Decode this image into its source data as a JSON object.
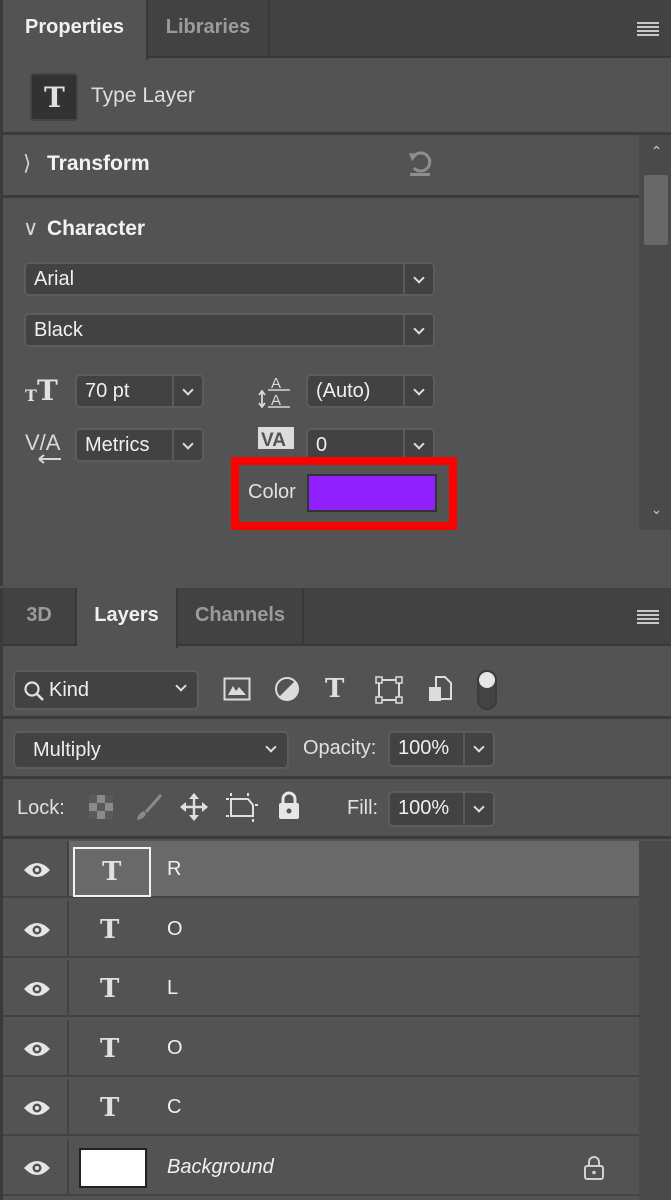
{
  "properties_panel": {
    "tabs": [
      {
        "label": "Properties",
        "active": true
      },
      {
        "label": "Libraries",
        "active": false
      }
    ],
    "layer_kind": {
      "icon": "type-layer-icon",
      "label": "Type Layer"
    },
    "transform": {
      "label": "Transform",
      "expanded": false,
      "reset_icon": "reset-icon"
    },
    "character": {
      "label": "Character",
      "expanded": true,
      "font_family": "Arial",
      "font_style": "Black",
      "font_size": "70 pt",
      "leading": "(Auto)",
      "kerning": "Metrics",
      "tracking": "0",
      "color_label": "Color",
      "color_value": "#9021fe"
    },
    "scrollbar": {
      "up_icon": "chevron-up-icon",
      "down_icon": "chevron-down-icon"
    },
    "highlight_color": "#ff0000"
  },
  "layers_panel": {
    "tabs": [
      {
        "label": "3D",
        "active": false
      },
      {
        "label": "Layers",
        "active": true
      },
      {
        "label": "Channels",
        "active": false
      }
    ],
    "filter": {
      "label": "Kind"
    },
    "blend_mode": "Multiply",
    "opacity_label": "Opacity:",
    "opacity_value": "100%",
    "lock_label": "Lock:",
    "fill_label": "Fill:",
    "fill_value": "100%",
    "layers": [
      {
        "name": "R",
        "type": "text",
        "visible": true,
        "selected": true
      },
      {
        "name": "O",
        "type": "text",
        "visible": true,
        "selected": false
      },
      {
        "name": "L",
        "type": "text",
        "visible": true,
        "selected": false
      },
      {
        "name": "O",
        "type": "text",
        "visible": true,
        "selected": false
      },
      {
        "name": "C",
        "type": "text",
        "visible": true,
        "selected": false
      },
      {
        "name": "Background",
        "type": "background",
        "visible": true,
        "selected": false,
        "locked": true
      }
    ]
  }
}
